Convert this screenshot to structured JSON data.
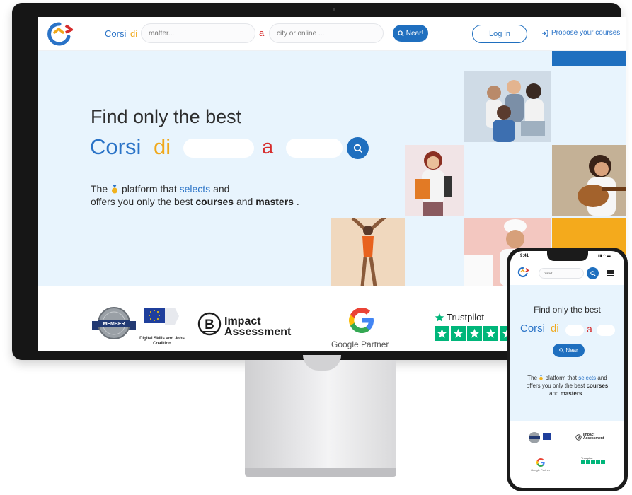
{
  "header": {
    "brand_corsi": "Corsi",
    "brand_di": "di",
    "matter_placeholder": "matter...",
    "a_letter": "a",
    "city_placeholder": "city or online ...",
    "near_label": "Near!",
    "login_label": "Log in",
    "propose_label": "Propose your courses"
  },
  "hero": {
    "title": "Find only the best",
    "corsi": "Corsi",
    "di": "di",
    "a_letter": "a",
    "desc_the": "The",
    "desc_platform": "platform that",
    "desc_selects": "selects",
    "desc_and": "and",
    "desc_line2": "offers you only the best",
    "desc_courses": "courses",
    "desc_and2": "and",
    "desc_masters": "masters",
    "desc_period": "."
  },
  "badges": {
    "member": "MEMBER",
    "eu_text": "Digital Skills and Jobs Coalition",
    "impact_line1": "Impact",
    "impact_line2": "Assessment",
    "google_partner": "Google Partner",
    "trustpilot": "Trustpilot"
  },
  "phone": {
    "time": "9:41",
    "near_placeholder": "Near...",
    "title": "Find only the best",
    "corsi": "Corsi",
    "di": "di",
    "a_letter": "a",
    "near_label": "Near",
    "desc_the": "The",
    "desc_platform": "platform that",
    "desc_selects": "selects",
    "desc_and": "and",
    "desc_line2": "offers you only the best",
    "desc_courses": "courses",
    "desc_and2": "and",
    "desc_masters": "masters",
    "desc_period": ".",
    "impact_line1": "Impact",
    "impact_line2": "Assessment",
    "google_partner": "Google Partner",
    "trustpilot": "Trustpilot"
  },
  "colors": {
    "brand_blue": "#1f6fbf",
    "brand_orange": "#f0a81a",
    "brand_red": "#d62d2d",
    "hero_bg": "#e8f4fd",
    "trustpilot_green": "#00b67a"
  },
  "icons": {
    "logo": "corsidia-logo-icon",
    "search": "search-icon",
    "propose": "login-arrow-icon",
    "medal": "medal-icon",
    "menu": "hamburger-menu-icon",
    "star": "star-icon"
  }
}
